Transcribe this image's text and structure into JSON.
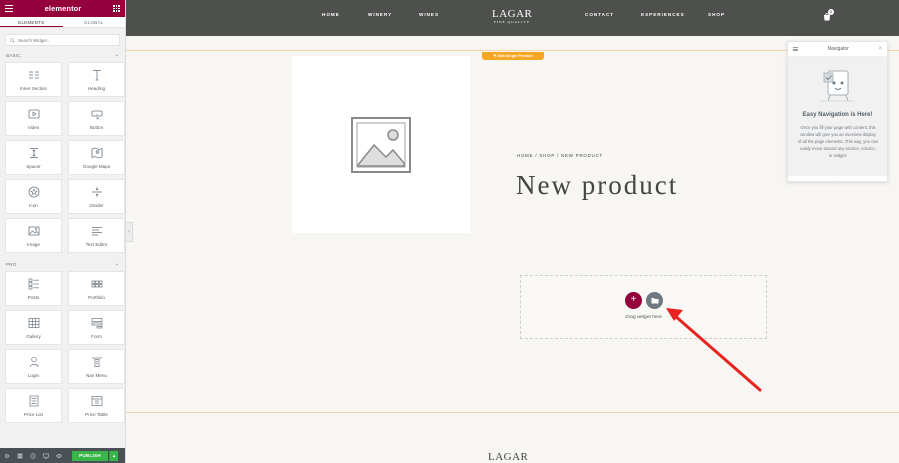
{
  "panel": {
    "brand": "elementor",
    "tabs": [
      "ELEMENTS",
      "GLOBAL"
    ],
    "search_placeholder": "Search Widget...",
    "categories": {
      "basic": {
        "title": "BASIC",
        "widgets": [
          {
            "label": "Inner Section",
            "icon": "inner-section-icon"
          },
          {
            "label": "Heading",
            "icon": "heading-icon"
          },
          {
            "label": "Video",
            "icon": "video-icon"
          },
          {
            "label": "Button",
            "icon": "button-icon"
          },
          {
            "label": "Spacer",
            "icon": "spacer-icon"
          },
          {
            "label": "Google Maps",
            "icon": "google-maps-icon"
          },
          {
            "label": "Icon",
            "icon": "star-icon"
          },
          {
            "label": "Divider",
            "icon": "divider-icon"
          },
          {
            "label": "Image",
            "icon": "image-icon"
          },
          {
            "label": "Text Editor",
            "icon": "text-editor-icon"
          }
        ]
      },
      "pro": {
        "title": "PRO",
        "widgets": [
          {
            "label": "Posts",
            "icon": "posts-icon"
          },
          {
            "label": "Portfolio",
            "icon": "portfolio-icon"
          },
          {
            "label": "Gallery",
            "icon": "gallery-icon"
          },
          {
            "label": "Form",
            "icon": "form-icon"
          },
          {
            "label": "Login",
            "icon": "login-icon"
          },
          {
            "label": "Nav Menu",
            "icon": "nav-menu-icon"
          },
          {
            "label": "Price List",
            "icon": "price-list-icon"
          },
          {
            "label": "Price Table",
            "icon": "price-table-icon"
          }
        ]
      }
    },
    "footer": {
      "publish_label": "PUBLISH",
      "icons": [
        "settings-icon",
        "navigator-icon",
        "history-icon",
        "responsive-icon",
        "preview-icon"
      ]
    }
  },
  "site": {
    "nav_left": [
      "HOME",
      "WINERY",
      "WINES"
    ],
    "nav_right": [
      "CONTACT",
      "EXPERIENCES",
      "SHOP"
    ],
    "logo_main": "LAGAR",
    "logo_sub": "FINE QUALITY",
    "cart_count": "0"
  },
  "canvas": {
    "edit_tab_label": "Edit Single Product",
    "breadcrumb": "HOME / SHOP / NEW PRODUCT",
    "product_title": "New product",
    "drop_zone_label": "Drag widget here",
    "footer_logo": "LAGAR"
  },
  "navigator": {
    "title": "Navigator",
    "heading": "Easy Navigation is Here!",
    "description": "Once you fill your page with content, this window will give you an overview display of all the page elements. This way, you can easily move around any section, column, or widget."
  },
  "colors": {
    "brand": "#93003c",
    "header_bg": "#4d504c",
    "publish": "#39b54a",
    "edit_tab": "#f5a623",
    "annotation_arrow": "#e8231f"
  }
}
